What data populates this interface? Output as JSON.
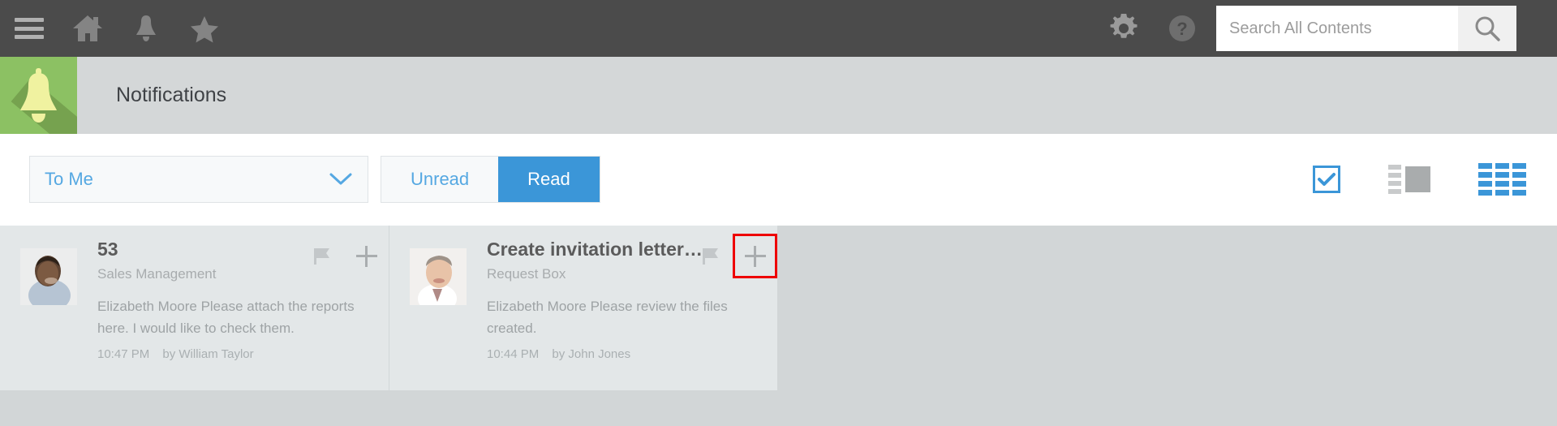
{
  "topbar": {
    "menu_icon": "hamburger-icon",
    "home_icon": "home-icon",
    "bell_icon": "bell-icon",
    "star_icon": "star-icon",
    "gear_icon": "gear-icon",
    "help_icon": "help-icon",
    "search_icon": "search-icon",
    "search": {
      "value": "",
      "placeholder": "Search All Contents"
    },
    "bg_color": "#4b4b4b"
  },
  "page_header": {
    "title": "Notifications",
    "icon": "bell-icon",
    "icon_bg_color": "#8cc163",
    "bg_color": "#d4d7d8"
  },
  "filter_bar": {
    "dropdown": {
      "selected": "To Me",
      "chevron_icon": "chevron-down-icon",
      "options": [
        "To Me"
      ]
    },
    "tabs": [
      {
        "label": "Unread",
        "active": false
      },
      {
        "label": "Read",
        "active": true
      }
    ],
    "active_tab_color": "#3b96d8",
    "view_options": [
      {
        "name": "select-mode-checkbox",
        "icon": "checkbox-checked-icon",
        "active": true
      },
      {
        "name": "list-view-toggle",
        "icon": "list-view-icon",
        "active": false
      },
      {
        "name": "grid-view-toggle",
        "icon": "grid-view-icon",
        "active": true
      }
    ]
  },
  "notifications": [
    {
      "avatar": "avatar-male-1",
      "title": "53",
      "subtitle": "Sales Management",
      "message": "Elizabeth Moore Please attach the reports here. I would like to check them.",
      "time": "10:47 PM",
      "author": "by William Taylor",
      "flag_icon": "flag-icon",
      "add_icon": "plus-icon",
      "highlighted": false
    },
    {
      "avatar": "avatar-male-2",
      "title": "Create invitation letter…",
      "subtitle": "Request Box",
      "message": "Elizabeth Moore Please review the files created.",
      "time": "10:44 PM",
      "author": "by John Jones",
      "flag_icon": "flag-icon",
      "add_icon": "plus-icon",
      "highlighted": true
    }
  ],
  "highlight_color": "#ee0000"
}
